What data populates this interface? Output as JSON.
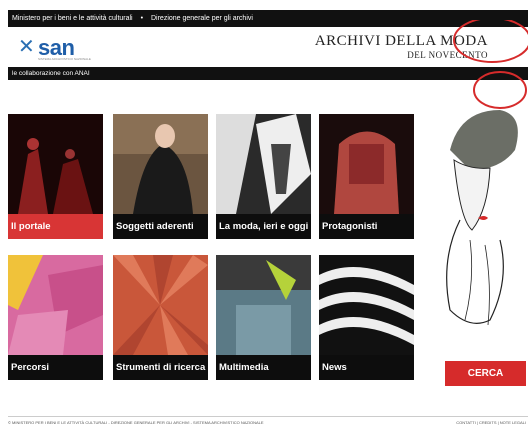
{
  "topbar": {
    "ministry": "Ministero per i beni e le attività culturali",
    "separator": "•",
    "direction": "Direzione generale per gli archivi"
  },
  "header": {
    "logo_text": "san",
    "logo_subtitle": "SISTEMA ARCHIVISTICO NAZIONALE",
    "title_line1": "ARCHIVI DELLA MODA",
    "title_line2": "DEL NOVECENTO"
  },
  "collab": {
    "text": "le collaborazione con ANAI"
  },
  "tiles": [
    {
      "label": "Il portale",
      "active": true
    },
    {
      "label": "Soggetti aderenti"
    },
    {
      "label": "La moda, ieri e oggi"
    },
    {
      "label": "Protagonisti"
    },
    {
      "label": "Percorsi"
    },
    {
      "label": "Strumenti di ricerca"
    },
    {
      "label": "Multimedia"
    },
    {
      "label": "News"
    }
  ],
  "search": {
    "button_label": "CERCA"
  },
  "footer": {
    "left": "© MINISTERO PER I BENI E LE ATTIVITÀ CULTURALI - DIREZIONE GENERALE PER GLI ARCHIVI - SISTEMA ARCHIVISTICO NAZIONALE",
    "right": "CONTATTI | CREDITS | NOTE LEGALI"
  },
  "colors": {
    "accent": "#d83535",
    "brand": "#1f5ea8",
    "dark": "#111111"
  }
}
